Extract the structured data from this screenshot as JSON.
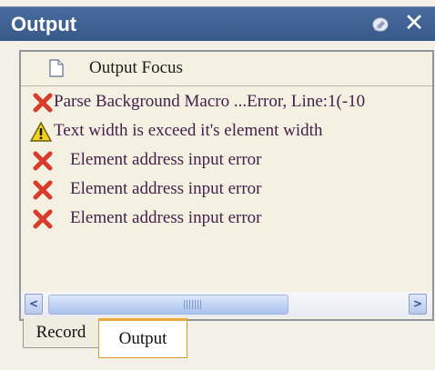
{
  "panel": {
    "title": "Output",
    "pin_icon": "pin-icon",
    "close_label": "✕"
  },
  "focus": {
    "icon": "document-icon",
    "label": "Output Focus"
  },
  "messages": [
    {
      "type": "error",
      "icon": "error-x-icon",
      "text": "Parse Background Macro ...Error, Line:1(-10"
    },
    {
      "type": "warning",
      "icon": "warning-triangle-icon",
      "text": "Text width is exceed it's element width"
    },
    {
      "type": "error",
      "icon": "error-x-icon",
      "text": "Element address input error"
    },
    {
      "type": "error",
      "icon": "error-x-icon",
      "text": "Element address input error"
    },
    {
      "type": "error",
      "icon": "error-x-icon",
      "text": "Element address input error"
    }
  ],
  "scrollbar": {
    "left_arrow": "<",
    "right_arrow": ">"
  },
  "tabs": [
    {
      "label": "Record",
      "active": false
    },
    {
      "label": "Output",
      "active": true
    }
  ],
  "colors": {
    "titlebar": "#3f6194",
    "error": "#d93b2b",
    "warning": "#f2d21a",
    "message_text": "#45204a",
    "active_tab_border": "#e8a93a"
  }
}
